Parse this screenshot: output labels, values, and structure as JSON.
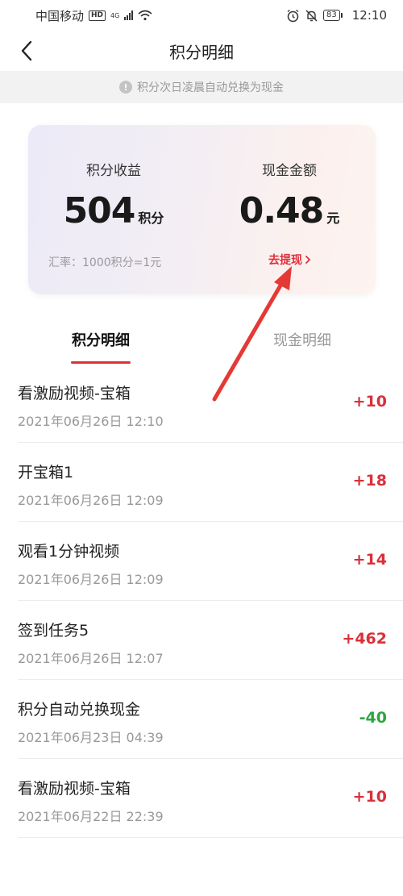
{
  "status_bar": {
    "carrier": "中国移动",
    "hd": "HD",
    "network": "4G",
    "battery": "83",
    "time": "12:10"
  },
  "nav": {
    "title": "积分明细"
  },
  "notice": {
    "text": "积分次日凌晨自动兑换为现金"
  },
  "summary": {
    "points_label": "积分收益",
    "points_value": "504",
    "points_unit": "积分",
    "cash_label": "现金金额",
    "cash_value": "0.48",
    "cash_unit": "元",
    "rate_text": "汇率：1000积分=1元",
    "withdraw_label": "去提现"
  },
  "tabs": [
    {
      "label": "积分明细",
      "active": true
    },
    {
      "label": "现金明细",
      "active": false
    }
  ],
  "records": [
    {
      "title": "看激励视频-宝箱",
      "time": "2021年06月26日 12:10",
      "amount": "+10"
    },
    {
      "title": "开宝箱1",
      "time": "2021年06月26日 12:09",
      "amount": "+18"
    },
    {
      "title": "观看1分钟视频",
      "time": "2021年06月26日 12:09",
      "amount": "+14"
    },
    {
      "title": "签到任务5",
      "time": "2021年06月26日 12:07",
      "amount": "+462"
    },
    {
      "title": "积分自动兑换现金",
      "time": "2021年06月23日 04:39",
      "amount": "-40"
    },
    {
      "title": "看激励视频-宝箱",
      "time": "2021年06月22日 22:39",
      "amount": "+10"
    }
  ],
  "colors": {
    "accent": "#e0303a",
    "positive": "#d9303a",
    "negative": "#2aa63f",
    "annotation_arrow": "#e53935"
  },
  "icons": {
    "back": "chevron-left-icon",
    "info": "info-icon",
    "withdraw": "chevron-right-icon",
    "wifi": "wifi-icon",
    "alarm": "alarm-icon",
    "mute": "bell-off-icon"
  }
}
